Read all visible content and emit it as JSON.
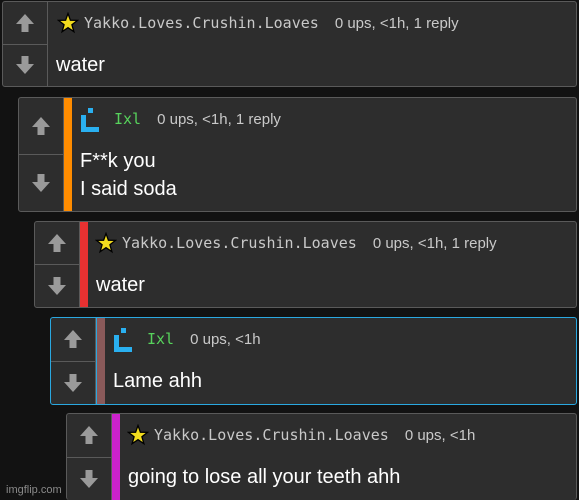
{
  "comments": [
    {
      "username": "Yakko.Loves.Crushin.Loaves",
      "badge_icon": "star-badge-icon",
      "stats": "0 ups, <1h, 1 reply",
      "lines": [
        "water"
      ],
      "stripe_color": ""
    },
    {
      "username": "Ixl",
      "badge_icon": "blue-bracket-badge-icon",
      "stats": "0 ups, <1h, 1 reply",
      "lines": [
        "F**k you",
        "I said soda"
      ],
      "stripe_color": "#ff8c00"
    },
    {
      "username": "Yakko.Loves.Crushin.Loaves",
      "badge_icon": "star-badge-icon",
      "stats": "0 ups, <1h, 1 reply",
      "lines": [
        "water"
      ],
      "stripe_color": "#e83131"
    },
    {
      "username": "Ixl",
      "badge_icon": "blue-bracket-badge-icon",
      "stats": "0 ups, <1h",
      "lines": [
        "Lame ahh"
      ],
      "stripe_color": "#8a5a5a",
      "highlight_border": "#2aa8e0"
    },
    {
      "username": "Yakko.Loves.Crushin.Loaves",
      "badge_icon": "star-badge-icon",
      "stats": "0 ups, <1h",
      "lines": [
        "going to lose all your teeth ahh"
      ],
      "stripe_color": "#cc22cc"
    }
  ],
  "vote_icons": {
    "up": "up-arrow-icon",
    "down": "down-arrow-icon"
  },
  "watermark": "imgflip.com"
}
